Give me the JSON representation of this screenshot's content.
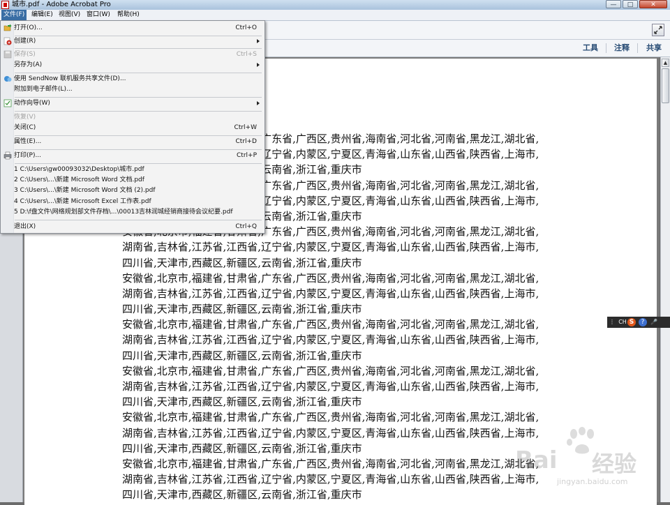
{
  "window": {
    "title": "城市.pdf - Adobe Acrobat Pro",
    "minimize": "—",
    "maximize": "□",
    "close": "✕"
  },
  "menubar": [
    {
      "label": "文件(F)"
    },
    {
      "label": "编辑(E)"
    },
    {
      "label": "视图(V)"
    },
    {
      "label": "窗口(W)"
    },
    {
      "label": "帮助(H)"
    }
  ],
  "tasks": {
    "tools": "工具",
    "comment": "注释",
    "share": "共享"
  },
  "file_menu": {
    "open": {
      "label": "打开(O)...",
      "shortcut": "Ctrl+O"
    },
    "create": {
      "label": "创建(R)"
    },
    "save": {
      "label": "保存(S)",
      "shortcut": "Ctrl+S"
    },
    "save_as": {
      "label": "另存为(A)"
    },
    "sendnow": {
      "label": "使用 SendNow 联机服务共享文件(D)..."
    },
    "attach_email": {
      "label": "附加到电子邮件(L)..."
    },
    "action_wizard": {
      "label": "动作向导(W)"
    },
    "revert": {
      "label": "恢复(V)"
    },
    "close": {
      "label": "关闭(C)",
      "shortcut": "Ctrl+W"
    },
    "properties": {
      "label": "属性(E)...",
      "shortcut": "Ctrl+D"
    },
    "print": {
      "label": "打印(P)...",
      "shortcut": "Ctrl+P"
    },
    "recent": [
      "1 C:\\Users\\gw00093032\\Desktop\\城市.pdf",
      "2 C:\\Users\\...\\新建 Microsoft Word 文档.pdf",
      "3 C:\\Users\\...\\新建 Microsoft Word 文档 (2).pdf",
      "4 C:\\Users\\...\\新建 Microsoft Excel 工作表.pdf",
      "5 D:\\f盘文件\\网络规划部文件存档\\...\\00013吉林润城经销商接待会议纪要.pdf"
    ],
    "exit": {
      "label": "退出(X)",
      "shortcut": "Ctrl+Q"
    }
  },
  "document": {
    "lines": [
      "安徽省,北京市,福建省,甘肃省,广东省,广西区,贵州省,海南省,河北省,河南省,黑龙江,湖北省,",
      "湖南省,吉林省,江苏省,江西省,辽宁省,内蒙区,宁夏区,青海省,山东省,山西省,陕西省,上海市,",
      "四川省,天津市,西藏区,新疆区,云南省,浙江省,重庆市",
      "安徽省,北京市,福建省,甘肃省,广东省,广西区,贵州省,海南省,河北省,河南省,黑龙江,湖北省,",
      "湖南省,吉林省,江苏省,江西省,辽宁省,内蒙区,宁夏区,青海省,山东省,山西省,陕西省,上海市,",
      "四川省,天津市,西藏区,新疆区,云南省,浙江省,重庆市",
      "安徽省,北京市,福建省,甘肃省,广东省,广西区,贵州省,海南省,河北省,河南省,黑龙江,湖北省,",
      "湖南省,吉林省,江苏省,江西省,辽宁省,内蒙区,宁夏区,青海省,山东省,山西省,陕西省,上海市,",
      "四川省,天津市,西藏区,新疆区,云南省,浙江省,重庆市",
      "安徽省,北京市,福建省,甘肃省,广东省,广西区,贵州省,海南省,河北省,河南省,黑龙江,湖北省,",
      "湖南省,吉林省,江苏省,江西省,辽宁省,内蒙区,宁夏区,青海省,山东省,山西省,陕西省,上海市,",
      "四川省,天津市,西藏区,新疆区,云南省,浙江省,重庆市",
      "安徽省,北京市,福建省,甘肃省,广东省,广西区,贵州省,海南省,河北省,河南省,黑龙江,湖北省,",
      "湖南省,吉林省,江苏省,江西省,辽宁省,内蒙区,宁夏区,青海省,山东省,山西省,陕西省,上海市,",
      "四川省,天津市,西藏区,新疆区,云南省,浙江省,重庆市",
      "安徽省,北京市,福建省,甘肃省,广东省,广西区,贵州省,海南省,河北省,河南省,黑龙江,湖北省,",
      "湖南省,吉林省,江苏省,江西省,辽宁省,内蒙区,宁夏区,青海省,山东省,山西省,陕西省,上海市,",
      "四川省,天津市,西藏区,新疆区,云南省,浙江省,重庆市",
      "安徽省,北京市,福建省,甘肃省,广东省,广西区,贵州省,海南省,河北省,河南省,黑龙江,湖北省,",
      "湖南省,吉林省,江苏省,江西省,辽宁省,内蒙区,宁夏区,青海省,山东省,山西省,陕西省,上海市,",
      "四川省,天津市,西藏区,新疆区,云南省,浙江省,重庆市",
      "安徽省,北京市,福建省,甘肃省,广东省,广西区,贵州省,海南省,河北省,河南省,黑龙江,湖北省,",
      "湖南省,吉林省,江苏省,江西省,辽宁省,内蒙区,宁夏区,青海省,山东省,山西省,陕西省,上海市,",
      "四川省,天津市,西藏区,新疆区,云南省,浙江省,重庆市"
    ]
  },
  "ime_bar": {
    "lang": "CH",
    "logo": "S",
    "help": "?",
    "mic": "🎤"
  },
  "watermark": {
    "brand": "Bai",
    "brand2": "经验",
    "url": "jingyan.baidu.com"
  }
}
